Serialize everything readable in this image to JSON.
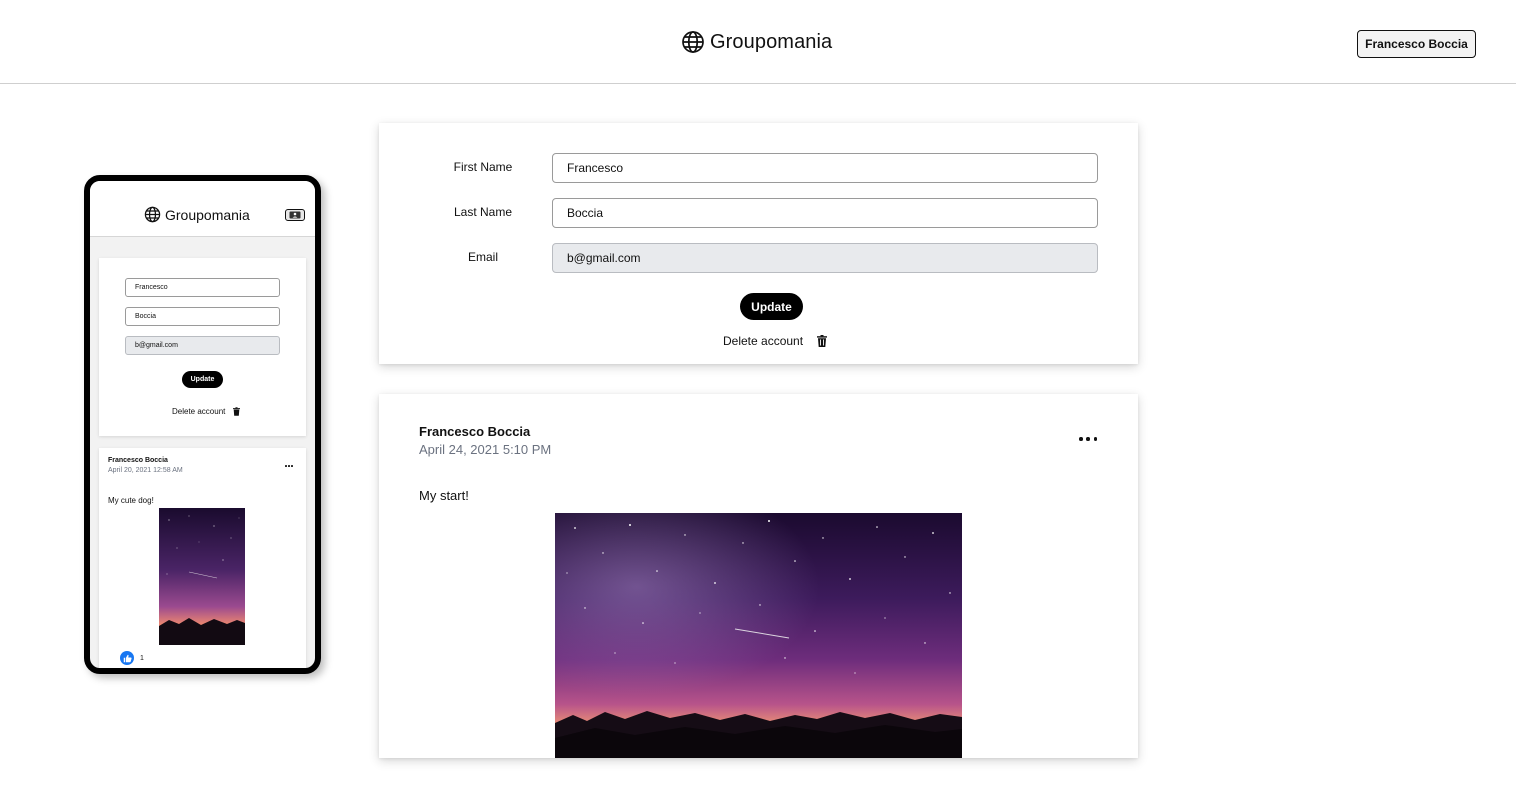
{
  "app": {
    "brand_name": "Groupomania",
    "brand_icon": "globe-icon",
    "current_user": "Francesco Boccia"
  },
  "profile_form": {
    "first_name_label": "First Name",
    "first_name_value": "Francesco",
    "last_name_label": "Last Name",
    "last_name_value": "Boccia",
    "email_label": "Email",
    "email_value": "b@gmail.com",
    "update_label": "Update",
    "delete_label": "Delete account",
    "delete_icon": "trash-icon"
  },
  "post": {
    "author": "Francesco Boccia",
    "date": "April 24, 2021 5:10 PM",
    "text": "My start!",
    "menu_icon": "more-horizontal-icon",
    "image": "night-sky-image"
  },
  "mobile_preview": {
    "brand_name": "Groupomania",
    "user_icon": "user-card-icon",
    "first_name_value": "Francesco",
    "last_name_value": "Boccia",
    "email_value": "b@gmail.com",
    "update_label": "Update",
    "delete_label": "Delete account",
    "post": {
      "author": "Francesco Boccia",
      "date": "April 20, 2021 12:58 AM",
      "text": "My cute dog!",
      "likes": "1",
      "like_icon": "thumbs-up-icon"
    }
  },
  "colors": {
    "accent": "#000000",
    "like_blue": "#1877f2",
    "muted_text": "#6b7280",
    "disabled_field": "#e8eaed"
  }
}
